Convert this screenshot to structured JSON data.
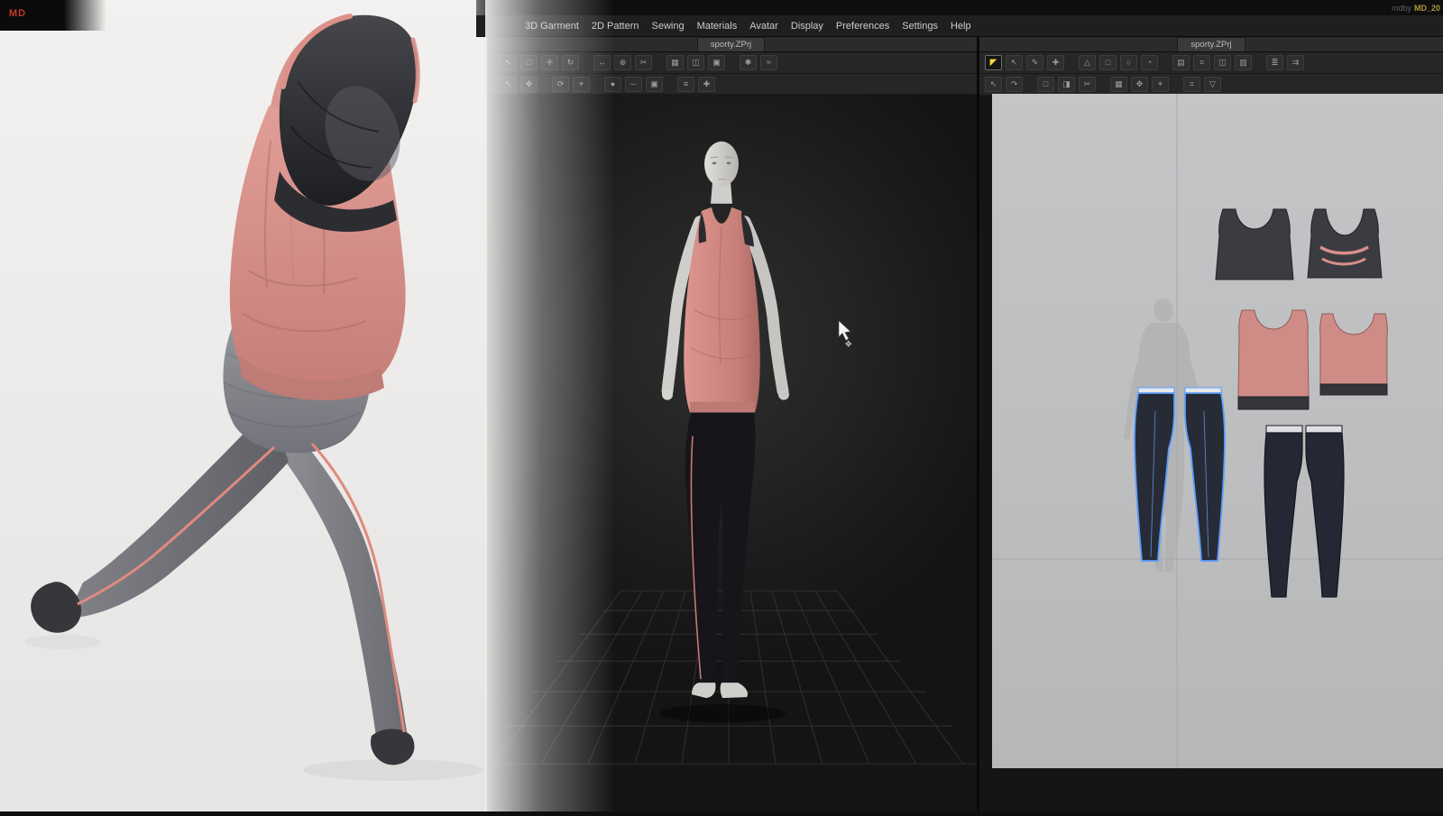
{
  "brand": {
    "logo": "MD",
    "watermark_prefix": "mdby",
    "watermark_id": "MD_20"
  },
  "menu": {
    "items": [
      "3D Garment",
      "2D Pattern",
      "Sewing",
      "Materials",
      "Avatar",
      "Display",
      "Preferences",
      "Settings",
      "Help"
    ]
  },
  "viewport3d": {
    "tab": "sporty.ZPrj",
    "toolbar1": [
      {
        "name": "select-tool",
        "glyph": "↖"
      },
      {
        "name": "box-select",
        "glyph": "□"
      },
      {
        "name": "move-gizmo",
        "glyph": "✛"
      },
      {
        "name": "rotate",
        "glyph": "↻"
      },
      {
        "name": "scale",
        "glyph": "↔"
      },
      {
        "name": "pin",
        "glyph": "⊕"
      },
      {
        "name": "scissors",
        "glyph": "✂"
      },
      {
        "name": "fabric",
        "glyph": "▦"
      },
      {
        "name": "panel-pair",
        "glyph": "◫"
      },
      {
        "name": "surface",
        "glyph": "▣"
      },
      {
        "name": "settings",
        "glyph": "✱"
      },
      {
        "name": "wind",
        "glyph": "≈"
      }
    ],
    "toolbar2": [
      {
        "name": "select-2",
        "glyph": "↖"
      },
      {
        "name": "transform",
        "glyph": "✥"
      },
      {
        "name": "orbit",
        "glyph": "⟳"
      },
      {
        "name": "focus",
        "glyph": "⌖"
      },
      {
        "name": "point",
        "glyph": "●"
      },
      {
        "name": "line",
        "glyph": "─"
      },
      {
        "name": "face",
        "glyph": "▣"
      },
      {
        "name": "list",
        "glyph": "≡"
      },
      {
        "name": "add",
        "glyph": "✚"
      }
    ]
  },
  "panel2d": {
    "tab": "sporty.ZPrj",
    "toolbar1": [
      {
        "name": "transform-pattern",
        "glyph": "◤"
      },
      {
        "name": "edit-pattern",
        "glyph": "↖"
      },
      {
        "name": "edit-curvature",
        "glyph": "✎"
      },
      {
        "name": "add-point",
        "glyph": "✚"
      },
      {
        "name": "polygon",
        "glyph": "△"
      },
      {
        "name": "rectangle",
        "glyph": "□"
      },
      {
        "name": "circle",
        "glyph": "○"
      },
      {
        "name": "dart",
        "glyph": "◔"
      },
      {
        "name": "internal-shape",
        "glyph": "▤"
      },
      {
        "name": "grading",
        "glyph": "⌗"
      },
      {
        "name": "notch",
        "glyph": "◫"
      },
      {
        "name": "seam-allowance",
        "glyph": "▥"
      },
      {
        "name": "layer",
        "glyph": "≣"
      },
      {
        "name": "sync",
        "glyph": "⇉"
      }
    ],
    "toolbar2": [
      {
        "name": "select-pattern",
        "glyph": "↖"
      },
      {
        "name": "rotate-pattern",
        "glyph": "↷"
      },
      {
        "name": "box-tool",
        "glyph": "□"
      },
      {
        "name": "mirror",
        "glyph": "◨"
      },
      {
        "name": "cut",
        "glyph": "✂"
      },
      {
        "name": "grid",
        "glyph": "▦"
      },
      {
        "name": "move",
        "glyph": "✥"
      },
      {
        "name": "target",
        "glyph": "⌖"
      },
      {
        "name": "measure",
        "glyph": "⌗"
      },
      {
        "name": "texture",
        "glyph": "▽"
      }
    ]
  },
  "colors": {
    "accent_salmon": "#d88c85",
    "selection_blue": "#5b9cff",
    "active_tool_yellow": "#ffd83d",
    "pattern_canvas": "#bfc0c2",
    "viewport_bg": "#232323"
  }
}
